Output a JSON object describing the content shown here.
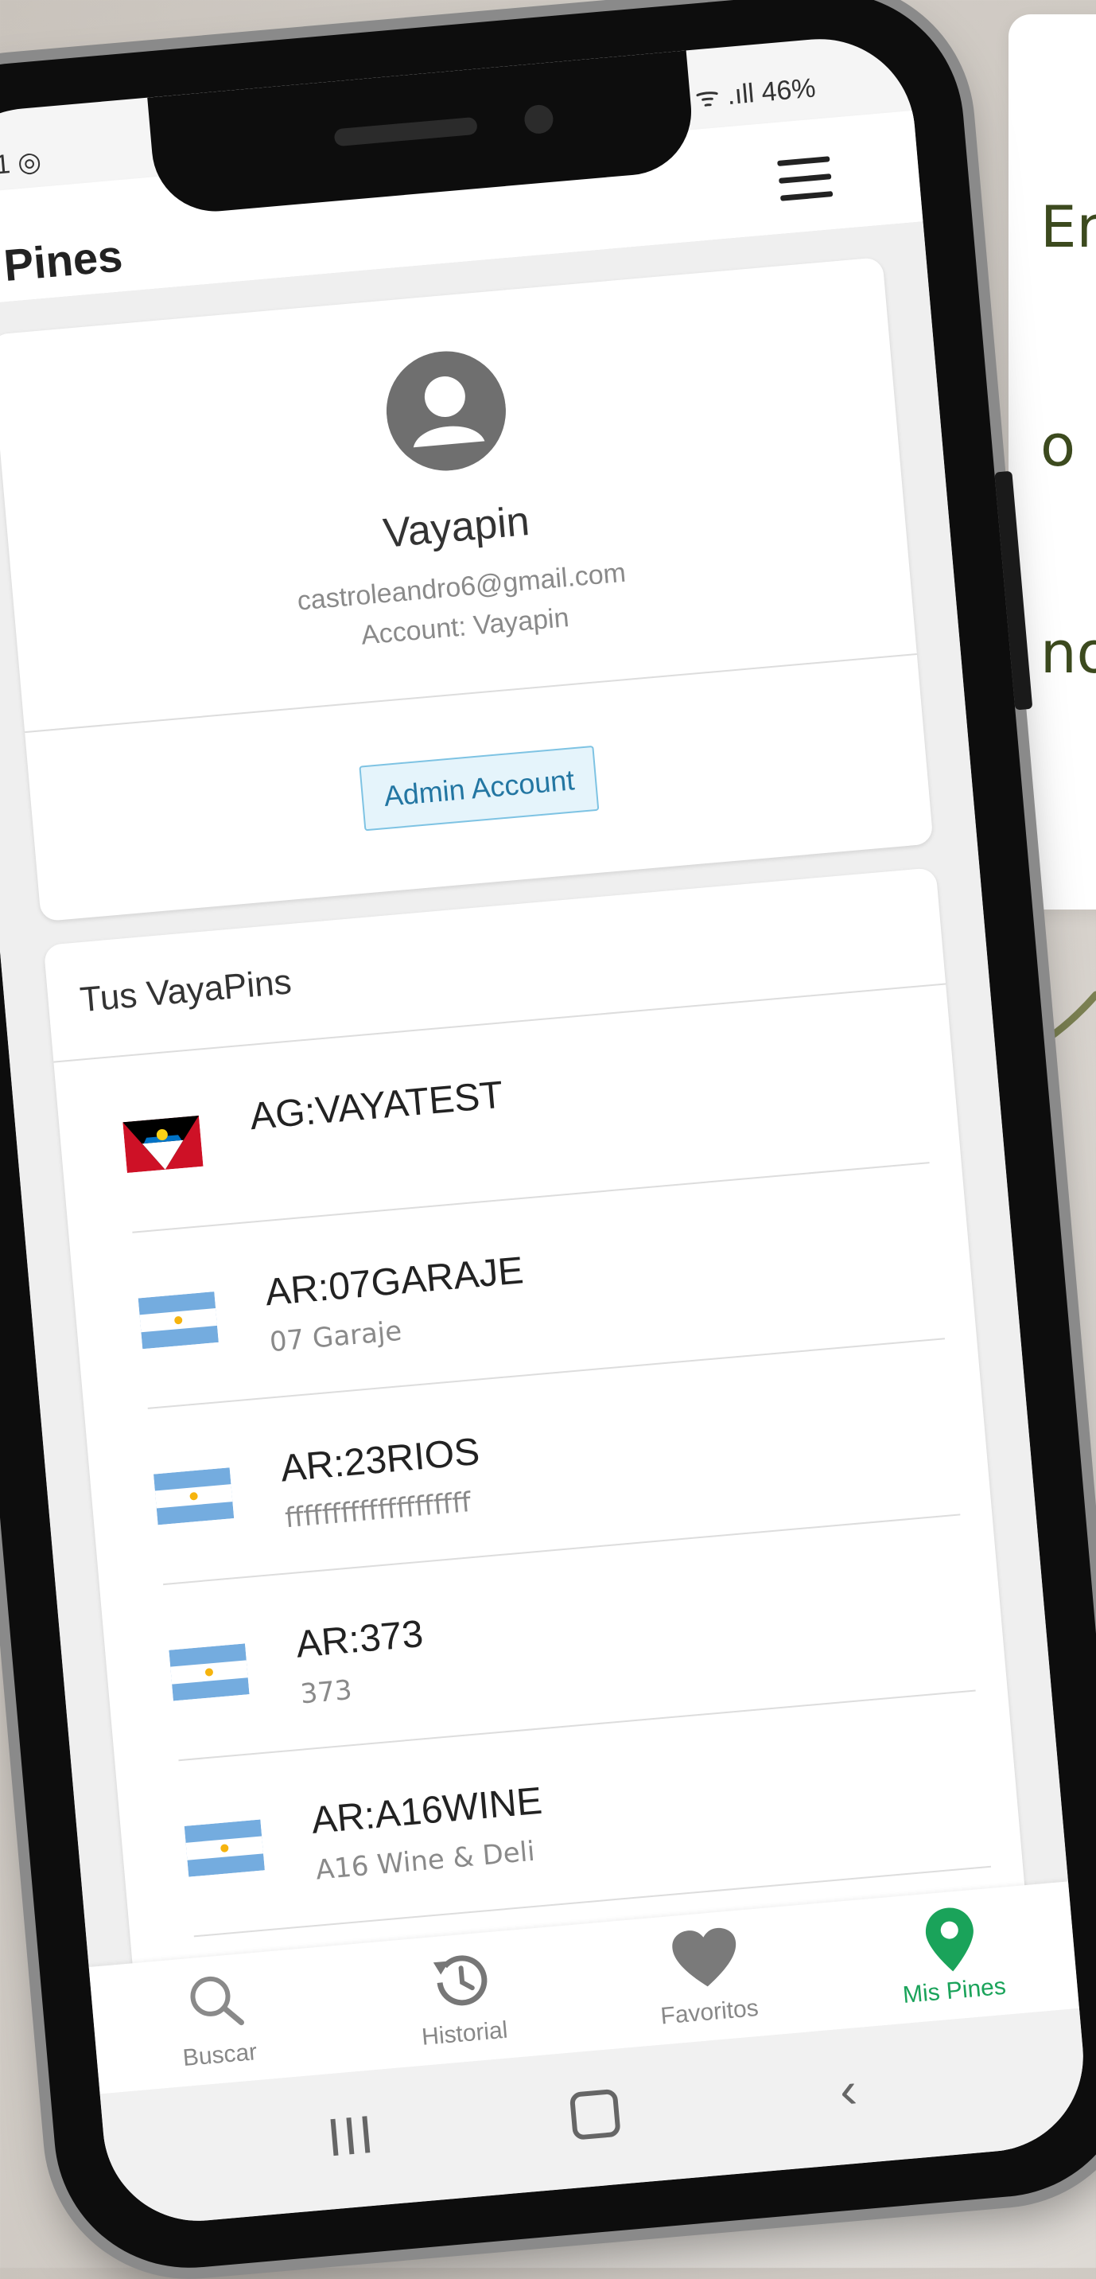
{
  "status": {
    "left": "1 ◎",
    "right": "ᯤ .ıll 46%"
  },
  "appbar": {
    "title": "Pines",
    "menu_icon": "hamburger-menu-icon"
  },
  "profile": {
    "name": "Vayapin",
    "email": "castroleandro6@gmail.com",
    "account": "Account: Vayapin",
    "admin_button": "Admin Account"
  },
  "pins": {
    "header": "Tus VayaPins",
    "items": [
      {
        "code": "AG:VAYATEST",
        "name": "",
        "flag": "antigua-barbuda-flag"
      },
      {
        "code": "AR:07GARAJE",
        "name": "07 Garaje",
        "flag": "argentina-flag"
      },
      {
        "code": "AR:23RIOS",
        "name": "ffffffffffffffffffff",
        "flag": "argentina-flag"
      },
      {
        "code": "AR:373",
        "name": "373",
        "flag": "argentina-flag"
      },
      {
        "code": "AR:A16WINE",
        "name": "A16 Wine & Deli",
        "flag": "argentina-flag"
      }
    ]
  },
  "nav": {
    "items": [
      {
        "label": "Buscar",
        "icon": "search-icon"
      },
      {
        "label": "Historial",
        "icon": "history-icon"
      },
      {
        "label": "Favoritos",
        "icon": "heart-icon"
      },
      {
        "label": "Mis Pines",
        "icon": "location-pin-icon",
        "active": true
      }
    ],
    "active_color": "#1aa35a"
  },
  "side_text": [
    "En",
    "o",
    "no"
  ],
  "colors": {
    "accent_green": "#1aa35a",
    "admin_blue": "#2376a2",
    "side_text": "#3c4a1e"
  }
}
